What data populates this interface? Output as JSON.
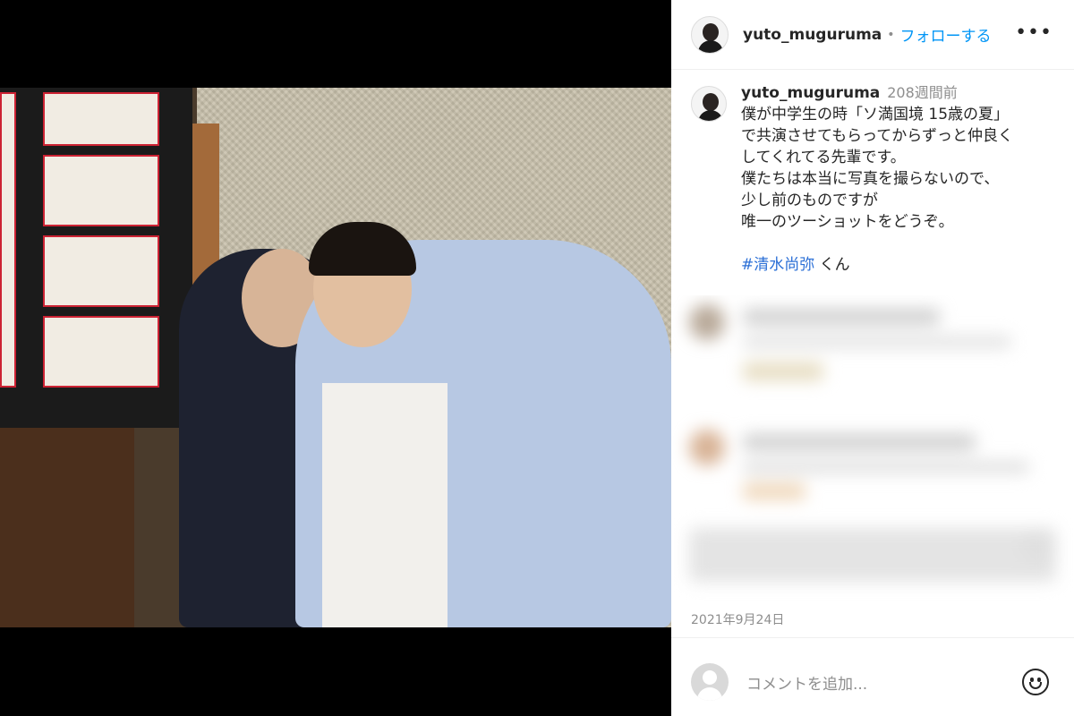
{
  "post": {
    "username": "yuto_muguruma",
    "follow_label": "フォローする",
    "separator": "•",
    "more_label": "•••"
  },
  "caption": {
    "username": "yuto_muguruma",
    "time": "208週間前",
    "lines": [
      "僕が中学生の時「ソ満国境 15歳の夏」",
      "で共演させてもらってからずっと仲良く",
      "してくれてる先輩です。",
      "僕たちは本当に写真を撮らないので、",
      "少し前のものですが",
      "唯一のツーショットをどうぞ。"
    ],
    "hashtag": "#清水尚弥",
    "hashtag_suffix": " くん"
  },
  "date": "2021年9月24日",
  "comment": {
    "placeholder": "コメントを追加..."
  },
  "icons": {
    "more": "more-options-icon",
    "emoji": "emoji-icon",
    "avatar": "avatar-icon"
  }
}
